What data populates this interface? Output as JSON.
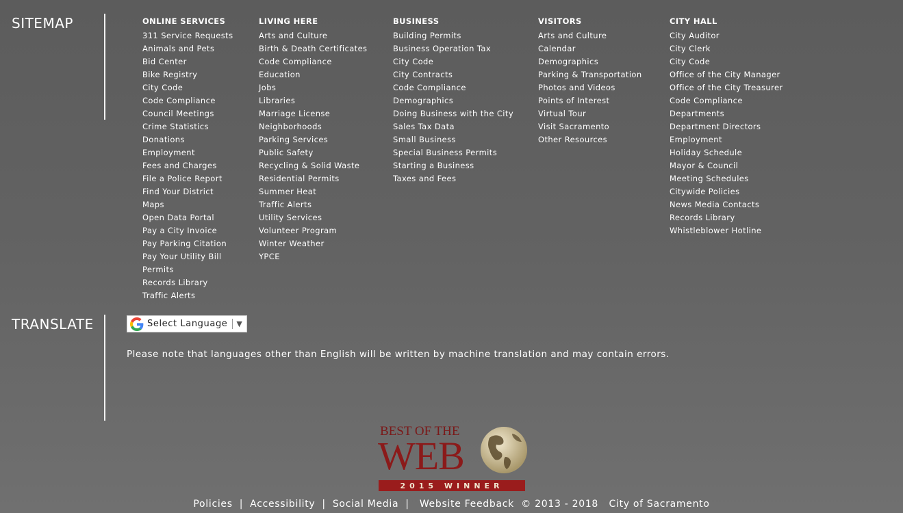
{
  "sitemap": {
    "title": "SITEMAP",
    "columns": [
      {
        "heading": "ONLINE SERVICES",
        "links": [
          "311 Service Requests",
          "Animals and Pets",
          "Bid Center",
          "Bike Registry",
          "City Code",
          "Code Compliance",
          "Council Meetings",
          "Crime Statistics",
          "Donations",
          "Employment",
          "Fees and Charges",
          "File a Police Report",
          "Find Your District",
          "Maps",
          "Open Data Portal",
          "Pay a City Invoice",
          "Pay Parking Citation",
          "Pay Your Utility Bill",
          "Permits",
          "Records Library",
          "Traffic Alerts"
        ]
      },
      {
        "heading": "LIVING HERE",
        "links": [
          "Arts and Culture",
          "Birth & Death Certificates",
          "Code Compliance",
          "Education",
          "Jobs",
          "Libraries",
          "Marriage License",
          "Neighborhoods",
          "Parking Services",
          "Public Safety",
          "Recycling & Solid Waste",
          "Residential Permits",
          "Summer Heat",
          "Traffic Alerts",
          "Utility Services",
          "Volunteer Program",
          "Winter Weather",
          "YPCE"
        ]
      },
      {
        "heading": "BUSINESS",
        "links": [
          "Building Permits",
          "Business Operation Tax",
          "City Code",
          "City Contracts",
          "Code Compliance",
          "Demographics",
          "Doing Business with the City",
          "Sales Tax Data",
          "Small Business",
          "Special Business Permits",
          "Starting a Business",
          "Taxes and Fees"
        ]
      },
      {
        "heading": "VISITORS",
        "links": [
          "Arts and Culture",
          "Calendar",
          "Demographics",
          "Parking & Transportation",
          "Photos and Videos",
          "Points of Interest",
          "Virtual Tour",
          "Visit Sacramento",
          "Other Resources"
        ]
      },
      {
        "heading": "CITY HALL",
        "links": [
          "City Auditor",
          "City Clerk",
          "City Code",
          "Office of the City Manager",
          "Office of the City Treasurer",
          "Code Compliance",
          "Departments",
          "Department Directors",
          "Employment",
          "Holiday Schedule",
          "Mayor & Council",
          "Meeting Schedules",
          "Citywide Policies",
          "News Media Contacts",
          "Records Library",
          "Whistleblower Hotline"
        ]
      }
    ]
  },
  "translate": {
    "title": "TRANSLATE",
    "select_label": "Select Language",
    "caret": "▼",
    "note": "Please note that languages other than English will be written by machine translation and may contain errors."
  },
  "award": {
    "line1": "BEST OF THE",
    "line2": "WEB",
    "line3": "2015 WINNER"
  },
  "footer": {
    "policies": "Policies",
    "accessibility": "Accessibility",
    "social_media": "Social Media",
    "website_feedback": "Website Feedback",
    "separator": "|",
    "copyright": "© 2013 - 2018",
    "city": "City of Sacramento"
  },
  "colors": {
    "background_top": "#5c5c5c",
    "background_bottom": "#707070",
    "award_red": "#8b1a1a",
    "award_gold": "#c9b98f"
  }
}
